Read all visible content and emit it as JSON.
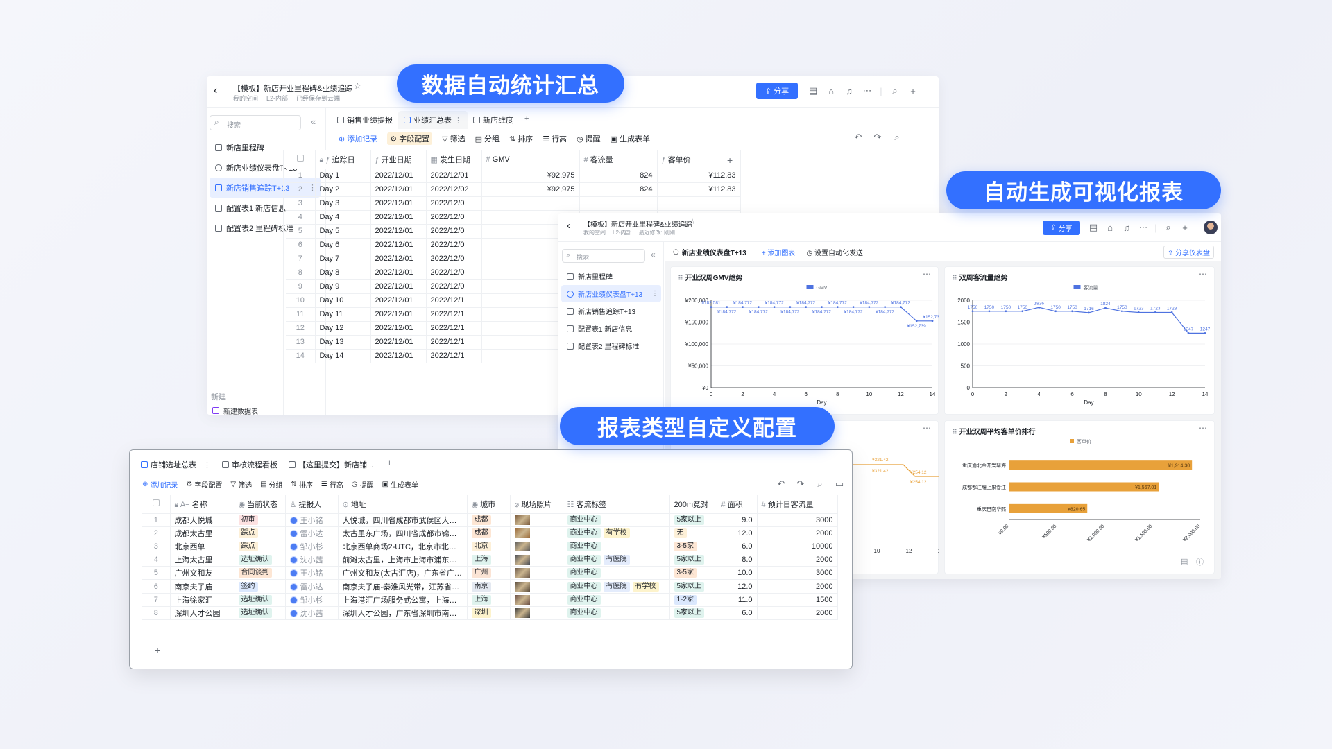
{
  "headlines": {
    "stats": "数据自动统计汇总",
    "charts": "自动生成可视化报表",
    "config": "报表类型自定义配置"
  },
  "colors": {
    "accent": "#3370ff",
    "orange": "#e8a13a"
  },
  "win1": {
    "title": "【模板】新店开业里程碑&业绩追踪",
    "sub1": "我的空间",
    "sub2": "L2-内部",
    "sub3": "已经保存到云端",
    "share": "分享",
    "search_placeholder": "搜索",
    "side": [
      "新店里程碑",
      "新店业绩仪表盘T+13",
      "新店销售追踪T+13",
      "配置表1 新店信息",
      "配置表2 里程碑标准"
    ],
    "new_label": "新建",
    "new_item": "新建数据表",
    "tabs": [
      "销售业绩提报",
      "业绩汇总表",
      "新店维度"
    ],
    "toolbar": [
      "添加记录",
      "字段配置",
      "筛选",
      "分组",
      "排序",
      "行高",
      "提醒",
      "生成表单"
    ],
    "columns": [
      "追踪日",
      "开业日期",
      "发生日期",
      "GMV",
      "客流量",
      "客单价"
    ],
    "rows": [
      [
        "1",
        "Day 1",
        "2022/12/01",
        "2022/12/01",
        "¥92,975",
        "824",
        "¥112.83"
      ],
      [
        "2",
        "Day 2",
        "2022/12/01",
        "2022/12/02",
        "¥92,975",
        "824",
        "¥112.83"
      ],
      [
        "3",
        "Day 3",
        "2022/12/01",
        "2022/12/0",
        "",
        "",
        ""
      ],
      [
        "4",
        "Day 4",
        "2022/12/01",
        "2022/12/0",
        "",
        "",
        ""
      ],
      [
        "5",
        "Day 5",
        "2022/12/01",
        "2022/12/0",
        "",
        "",
        ""
      ],
      [
        "6",
        "Day 6",
        "2022/12/01",
        "2022/12/0",
        "",
        "",
        ""
      ],
      [
        "7",
        "Day 7",
        "2022/12/01",
        "2022/12/0",
        "",
        "",
        ""
      ],
      [
        "8",
        "Day 8",
        "2022/12/01",
        "2022/12/0",
        "",
        "",
        ""
      ],
      [
        "9",
        "Day 9",
        "2022/12/01",
        "2022/12/0",
        "",
        "",
        ""
      ],
      [
        "10",
        "Day 10",
        "2022/12/01",
        "2022/12/1",
        "",
        "",
        ""
      ],
      [
        "11",
        "Day 11",
        "2022/12/01",
        "2022/12/1",
        "",
        "",
        ""
      ],
      [
        "12",
        "Day 12",
        "2022/12/01",
        "2022/12/1",
        "",
        "",
        ""
      ],
      [
        "13",
        "Day 13",
        "2022/12/01",
        "2022/12/1",
        "",
        "",
        ""
      ],
      [
        "14",
        "Day 14",
        "2022/12/01",
        "2022/12/1",
        "",
        "",
        ""
      ]
    ]
  },
  "win2": {
    "title": "【模板】新店开业里程碑&业绩追踪",
    "sub1": "我的空间",
    "sub2": "L2-内部",
    "sub3": "最近修改: 刚刚",
    "share": "分享",
    "search_placeholder": "搜索",
    "side": [
      "新店里程碑",
      "新店业绩仪表盘T+13",
      "新店销售追踪T+13",
      "配置表1 新店信息",
      "配置表2 里程碑标准"
    ],
    "dash_name": "新店业绩仪表盘T+13",
    "add_chart": "+ 添加图表",
    "auto_send": "设置自动化发送",
    "share_dash": "分享仪表盘",
    "c1_title": "开业双周GMV趋势",
    "c2_title": "双周客流量趋势",
    "c4_title": "开业双周平均客单价排行"
  },
  "chart_data": [
    {
      "type": "line",
      "title": "开业双周GMV趋势",
      "series": [
        {
          "name": "GMV",
          "x": [
            0,
            1,
            2,
            3,
            4,
            5,
            6,
            7,
            8,
            9,
            10,
            11,
            12,
            13,
            14
          ],
          "values": [
            184772,
            184772,
            184772,
            184772,
            184772,
            184772,
            184772,
            184772,
            184772,
            184772,
            184772,
            184772,
            184772,
            152739,
            152739
          ]
        }
      ],
      "point_labels": [
        "¥182,581",
        "¥184,772",
        "¥184,772",
        "¥184,772",
        "¥184,772",
        "¥184,772",
        "¥184,772",
        "¥184,772",
        "¥184,772",
        "¥184,772",
        "¥184,772",
        "¥184,772",
        "¥184,772",
        "¥152,739",
        "¥152,739"
      ],
      "yticks": [
        "¥0",
        "¥50,000",
        "¥100,000",
        "¥150,000",
        "¥200,000"
      ],
      "xticks": [
        "0",
        "2",
        "4",
        "6",
        "8",
        "10",
        "12",
        "14"
      ],
      "xlabel": "Day",
      "ylim": [
        0,
        200000
      ],
      "xlim": [
        0,
        14
      ],
      "legend": "top-center"
    },
    {
      "type": "line",
      "title": "双周客流量趋势",
      "series": [
        {
          "name": "客流量",
          "x": [
            0,
            1,
            2,
            3,
            4,
            5,
            6,
            7,
            8,
            9,
            10,
            11,
            12,
            13,
            14
          ],
          "values": [
            1750,
            1750,
            1750,
            1750,
            1836,
            1750,
            1750,
            1716,
            1824,
            1750,
            1723,
            1723,
            1723,
            1247,
            1247
          ]
        }
      ],
      "yticks": [
        "0",
        "500",
        "1000",
        "1500",
        "2000"
      ],
      "xticks": [
        "0",
        "2",
        "4",
        "6",
        "8",
        "10",
        "12",
        "14"
      ],
      "xlabel": "Day",
      "ylim": [
        0,
        2000
      ],
      "xlim": [
        0,
        14
      ],
      "legend": "top-center"
    },
    {
      "type": "bar",
      "title": "开业双周平均客单价排行",
      "series": [
        {
          "name": "客单价",
          "values": [
            1914.3,
            1567.01,
            820.65
          ]
        }
      ],
      "categories": [
        "重庆渝北金开爱琴海",
        "成都都江堰上果春江",
        "重庆巴南华熙"
      ],
      "value_labels": [
        "¥1,914.30",
        "¥1,567.01",
        "¥820.65"
      ],
      "xticks": [
        "¥0.00",
        "¥500.00",
        "¥1,000.00",
        "¥1,500.00",
        "¥2,000.00"
      ],
      "xlim": [
        0,
        2000
      ],
      "orientation": "horizontal",
      "legend": "top-center"
    }
  ],
  "win3": {
    "tabs": [
      "店铺选址总表",
      "审核流程看板",
      "【这里提交】新店铺..."
    ],
    "toolbar": [
      "添加记录",
      "字段配置",
      "筛选",
      "分组",
      "排序",
      "行高",
      "提醒",
      "生成表单"
    ],
    "columns": [
      "名称",
      "当前状态",
      "提报人",
      "地址",
      "城市",
      "现场照片",
      "客流标签",
      "200m竞对",
      "面积",
      "预计日客流量"
    ],
    "rows": [
      {
        "idx": "1",
        "name": "成都大悦城",
        "status": "初审",
        "owner": "王小铭",
        "addr": "大悦城，四川省成都市武侯区大悦...",
        "city": "成都",
        "tags": [
          "商业中心"
        ],
        "comp": "5家以上",
        "area": "9.0",
        "flow": "3000"
      },
      {
        "idx": "2",
        "name": "成都太古里",
        "status": "踩点",
        "owner": "雷小达",
        "addr": "太古里东广场，四川省成都市锦江...",
        "city": "成都",
        "tags": [
          "商业中心",
          "有学校"
        ],
        "comp": "无",
        "area": "12.0",
        "flow": "2000"
      },
      {
        "idx": "3",
        "name": "北京西单",
        "status": "踩点",
        "owner": "邹小杉",
        "addr": "北京西单商场2-UTC，北京市北京...",
        "city": "北京",
        "tags": [
          "商业中心"
        ],
        "comp": "3-5家",
        "area": "6.0",
        "flow": "10000"
      },
      {
        "idx": "4",
        "name": "上海太古里",
        "status": "选址确认",
        "owner": "沈小茜",
        "addr": "前滩太古里，上海市上海市浦东新...",
        "city": "上海",
        "tags": [
          "商业中心",
          "有医院"
        ],
        "comp": "5家以上",
        "area": "8.0",
        "flow": "2000"
      },
      {
        "idx": "5",
        "name": "广州文和友",
        "status": "合同谈判",
        "owner": "王小铭",
        "addr": "广州文和友(太古汇店)，广东省广州...",
        "city": "广州",
        "tags": [
          "商业中心"
        ],
        "comp": "3-5家",
        "area": "10.0",
        "flow": "3000"
      },
      {
        "idx": "6",
        "name": "南京夫子庙",
        "status": "签约",
        "owner": "雷小达",
        "addr": "南京夫子庙-秦淮风光带，江苏省南...",
        "city": "南京",
        "tags": [
          "商业中心",
          "有医院",
          "有学校"
        ],
        "comp": "5家以上",
        "area": "12.0",
        "flow": "2000"
      },
      {
        "idx": "7",
        "name": "上海徐家汇",
        "status": "选址确认",
        "owner": "邹小杉",
        "addr": "上海港汇广场服务式公寓，上海市...",
        "city": "上海",
        "tags": [
          "商业中心"
        ],
        "comp": "1-2家",
        "area": "11.0",
        "flow": "1500"
      },
      {
        "idx": "8",
        "name": "深圳人才公园",
        "status": "选址确认",
        "owner": "沈小茜",
        "addr": "深圳人才公园，广东省深圳市南山...",
        "city": "深圳",
        "tags": [
          "商业中心"
        ],
        "comp": "5家以上",
        "area": "6.0",
        "flow": "2000"
      }
    ],
    "peek_labels": [
      "¥321.42",
      "¥321.42",
      "¥254.12",
      "¥254.12"
    ]
  }
}
